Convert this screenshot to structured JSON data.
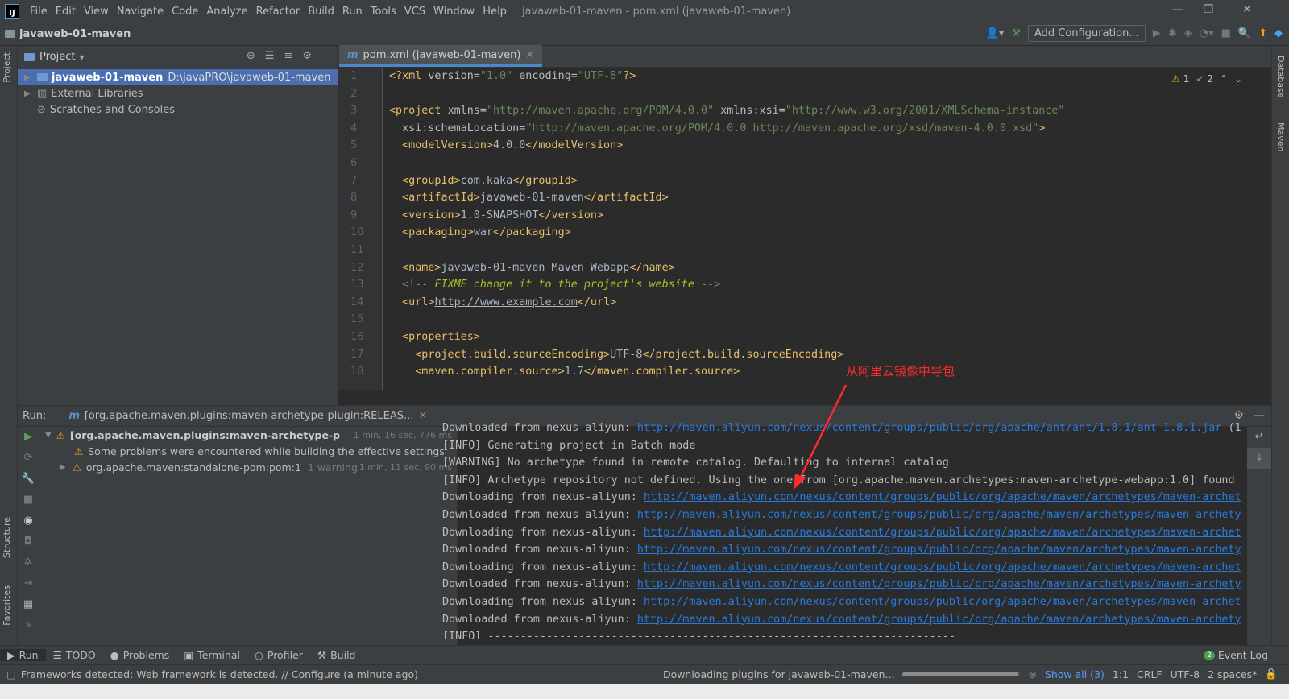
{
  "menubar": {
    "items": [
      "File",
      "Edit",
      "View",
      "Navigate",
      "Code",
      "Analyze",
      "Refactor",
      "Build",
      "Run",
      "Tools",
      "VCS",
      "Window",
      "Help"
    ],
    "title": "javaweb-01-maven - pom.xml (javaweb-01-maven)"
  },
  "navbar": {
    "project": "javaweb-01-maven",
    "add_config": "Add Configuration..."
  },
  "project_panel": {
    "title": "Project",
    "root_name": "javaweb-01-maven",
    "root_path": "D:\\javaPRO\\javaweb-01-maven",
    "items": [
      "External Libraries",
      "Scratches and Consoles"
    ]
  },
  "sidebar": {
    "left_tabs": [
      "Project",
      "Structure",
      "Favorites"
    ],
    "right_tabs": [
      "Database",
      "Maven"
    ]
  },
  "editor": {
    "tab": "pom.xml (javaweb-01-maven)",
    "warnings": "1",
    "checks": "2",
    "lines": [
      "1",
      "2",
      "3",
      "4",
      "5",
      "6",
      "7",
      "8",
      "9",
      "10",
      "11",
      "12",
      "13",
      "14",
      "15",
      "16",
      "17",
      "18"
    ]
  },
  "annotation": "从阿里云镜像中导包",
  "run": {
    "label": "Run:",
    "tab": "[org.apache.maven.plugins:maven-archetype-plugin:RELEAS...",
    "tree": [
      {
        "text": "[org.apache.maven.plugins:maven-archetype-plugin:REl",
        "time": "1 min, 16 sec, 776 ms"
      },
      {
        "text": "Some problems were encountered while building the effective settings",
        "time": ""
      },
      {
        "text": "org.apache.maven:standalone-pom:pom:1",
        "extra": "1 warning",
        "time": "1 min, 11 sec, 90 ms"
      }
    ],
    "console": [
      {
        "p": "Downloaded from nexus-aliyun: ",
        "u": "http://maven.aliyun.com/nexus/content/groups/public/org/apache/ant/ant/1.8.1/ant-1.8.1.jar",
        "s": " (1"
      },
      {
        "p": "[INFO] Generating project in Batch mode",
        "u": "",
        "s": ""
      },
      {
        "p": "[WARNING] No archetype found in remote catalog. Defaulting to internal catalog",
        "u": "",
        "s": ""
      },
      {
        "p": "[INFO] Archetype repository not defined. Using the one from [org.apache.maven.archetypes:maven-archetype-webapp:1.0] found",
        "u": "",
        "s": ""
      },
      {
        "p": "Downloading from nexus-aliyun: ",
        "u": "http://maven.aliyun.com/nexus/content/groups/public/org/apache/maven/archetypes/maven-archet",
        "s": ""
      },
      {
        "p": "Downloaded from nexus-aliyun: ",
        "u": "http://maven.aliyun.com/nexus/content/groups/public/org/apache/maven/archetypes/maven-archety",
        "s": ""
      },
      {
        "p": "Downloading from nexus-aliyun: ",
        "u": "http://maven.aliyun.com/nexus/content/groups/public/org/apache/maven/archetypes/maven-archet",
        "s": ""
      },
      {
        "p": "Downloaded from nexus-aliyun: ",
        "u": "http://maven.aliyun.com/nexus/content/groups/public/org/apache/maven/archetypes/maven-archety",
        "s": ""
      },
      {
        "p": "Downloading from nexus-aliyun: ",
        "u": "http://maven.aliyun.com/nexus/content/groups/public/org/apache/maven/archetypes/maven-archet",
        "s": ""
      },
      {
        "p": "Downloaded from nexus-aliyun: ",
        "u": "http://maven.aliyun.com/nexus/content/groups/public/org/apache/maven/archetypes/maven-archety",
        "s": ""
      },
      {
        "p": "Downloading from nexus-aliyun: ",
        "u": "http://maven.aliyun.com/nexus/content/groups/public/org/apache/maven/archetypes/maven-archet",
        "s": ""
      },
      {
        "p": "Downloaded from nexus-aliyun: ",
        "u": "http://maven.aliyun.com/nexus/content/groups/public/org/apache/maven/archetypes/maven-archety",
        "s": ""
      },
      {
        "p": "[INFO] ------------------------------------------------------------------------",
        "u": "",
        "s": ""
      }
    ]
  },
  "bottom_tabs": [
    "Run",
    "TODO",
    "Problems",
    "Terminal",
    "Profiler",
    "Build"
  ],
  "event_log": {
    "count": "2",
    "label": "Event Log"
  },
  "status": {
    "message": "Frameworks detected: Web framework is detected. // Configure (a minute ago)",
    "task": "Downloading plugins for javaweb-01-maven...",
    "show_all": "Show all (3)",
    "position": "1:1",
    "line_sep": "CRLF",
    "encoding": "UTF-8",
    "indent": "2 spaces*",
    "progress": 0.98
  },
  "colors": {
    "accent": "#4b6eaf",
    "annotation": "#ff2a2a",
    "link": "#287bde"
  }
}
